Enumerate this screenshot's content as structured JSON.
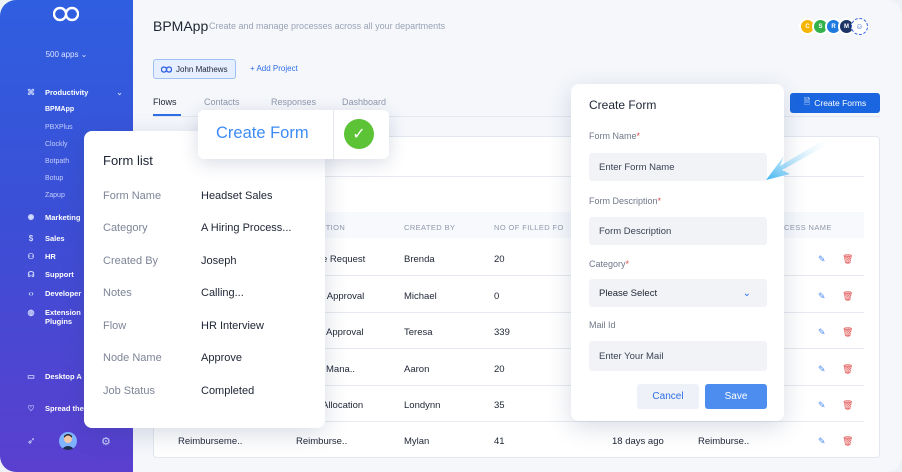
{
  "sidebar": {
    "apps_label": "500 apps",
    "items": [
      {
        "label": "Productivity",
        "icon": "command-icon"
      },
      {
        "label": "Marketing",
        "icon": "marketing-icon"
      },
      {
        "label": "Sales",
        "icon": "dollar-icon"
      },
      {
        "label": "HR",
        "icon": "hr-icon"
      },
      {
        "label": "Support",
        "icon": "headset-icon"
      },
      {
        "label": "Developer",
        "icon": "code-icon"
      },
      {
        "label": "Extension",
        "label2": "Plugins",
        "icon": "globe-icon"
      },
      {
        "label": "Desktop A",
        "icon": "monitor-icon"
      },
      {
        "label": "Spread the",
        "icon": "heart-icon"
      }
    ],
    "subitems": [
      "BPMApp",
      "PBXPlus",
      "Clockly",
      "Botpath",
      "Botup",
      "Zapup"
    ]
  },
  "header": {
    "title": "BPMApp",
    "subtitle": "Create and manage processes across all your departments",
    "badges": [
      {
        "text": "C",
        "color": "#f5b400"
      },
      {
        "text": "S",
        "color": "#33b24a"
      },
      {
        "text": "R",
        "color": "#1f7ae0"
      },
      {
        "text": "M",
        "color": "#1d3566"
      }
    ]
  },
  "project": {
    "name": "John Mathews",
    "add_label": "+ Add Project"
  },
  "tabs": [
    "Flows",
    "Contacts",
    "Responses",
    "Dashboard"
  ],
  "create_forms_button": "Create Forms",
  "table": {
    "headers": [
      "RIPTION",
      "CREATED BY",
      "NO OF FILLED FO",
      "CESS NAME"
    ],
    "rows": [
      {
        "desc": "e Request",
        "by": "Brenda",
        "filled": "20"
      },
      {
        "desc": "t Approval",
        "by": "Michael",
        "filled": "0"
      },
      {
        "desc": "Approval",
        "by": "Teresa",
        "filled": "339"
      },
      {
        "desc": "Mana..",
        "by": "Aaron",
        "filled": "20"
      },
      {
        "desc": "Allocation",
        "by": "Londynn",
        "filled": "35"
      },
      {
        "first": "Reimburseme..",
        "desc": "Reimburse..",
        "by": "Mylan",
        "filled": "41",
        "time": "18 days ago",
        "process": "Reimburse.."
      }
    ]
  },
  "form_list": {
    "title": "Form list",
    "fields": [
      {
        "label": "Form Name",
        "value": "Headset Sales"
      },
      {
        "label": "Category",
        "value": "A Hiring Process..."
      },
      {
        "label": "Created By",
        "value": "Joseph"
      },
      {
        "label": "Notes",
        "value": "Calling..."
      },
      {
        "label": "Flow",
        "value": "HR Interview"
      },
      {
        "label": "Node Name",
        "value": "Approve"
      },
      {
        "label": "Job Status",
        "value": "Completed"
      }
    ]
  },
  "create_popup": {
    "label": "Create Form"
  },
  "create_form": {
    "title": "Create Form",
    "name_label": "Form Name",
    "name_placeholder": "Enter Form Name",
    "desc_label": "Form Description",
    "desc_placeholder": "Form Description",
    "category_label": "Category",
    "category_value": "Please Select",
    "mail_label": "Mail Id",
    "mail_placeholder": "Enter Your Mail",
    "cancel": "Cancel",
    "save": "Save"
  }
}
